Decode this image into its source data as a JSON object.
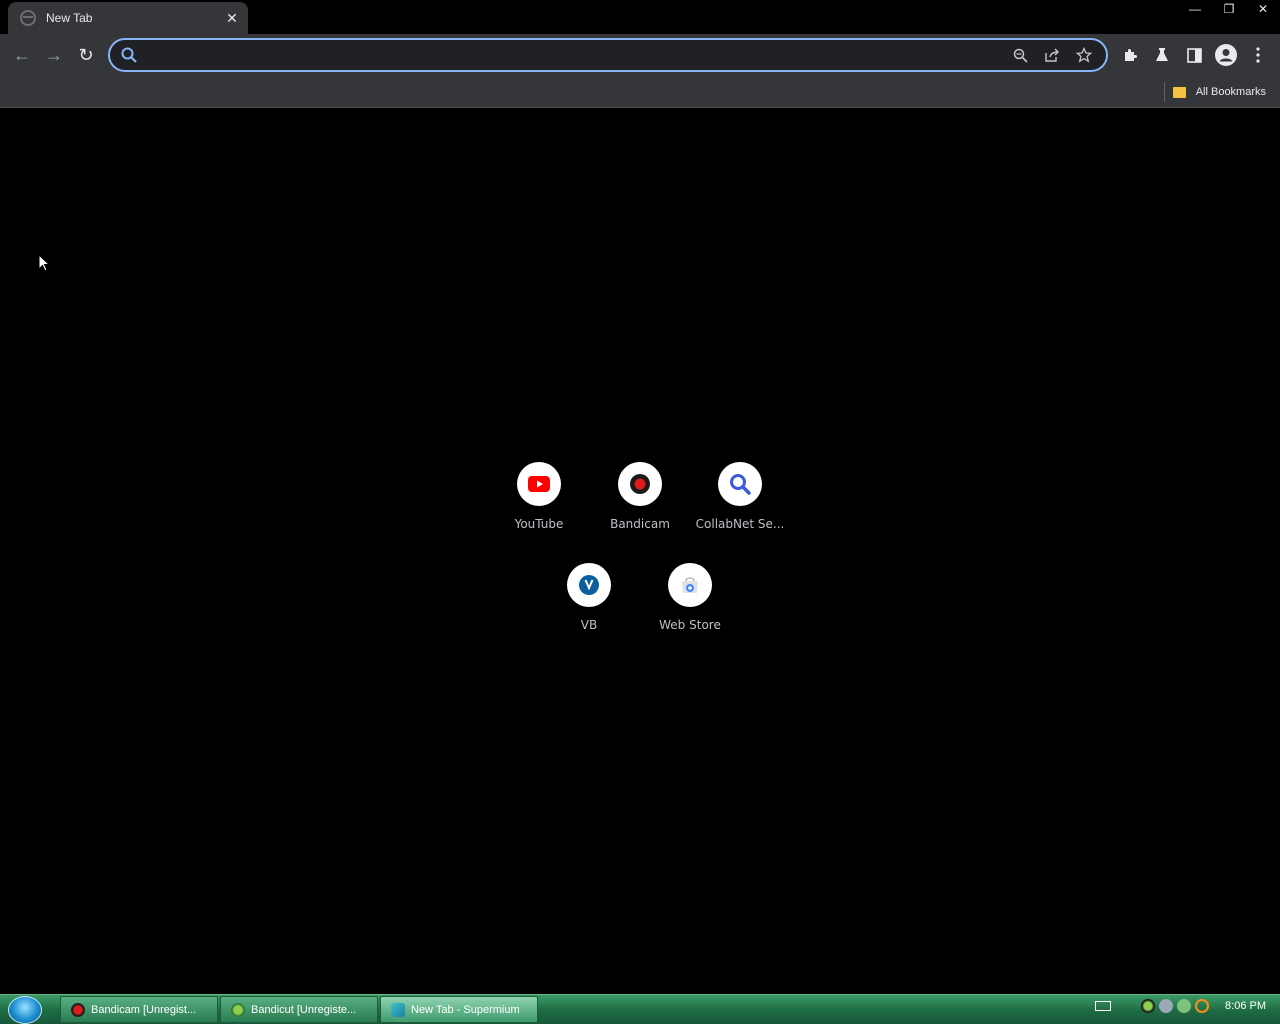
{
  "window": {
    "tab_title": "New Tab",
    "tab_close": "✕",
    "controls": {
      "minimize": "—",
      "restore": "❐",
      "close": "✕"
    }
  },
  "toolbar": {
    "back": "←",
    "forward": "→",
    "reload": "↻",
    "omnibox_value": "",
    "omnibox_placeholder": ""
  },
  "bookmarks": {
    "all_bookmarks": "All Bookmarks"
  },
  "shortcuts": [
    {
      "label": "YouTube",
      "icon": "youtube-icon",
      "color": "#ff0000"
    },
    {
      "label": "Bandicam",
      "icon": "bandicam-icon",
      "color": "#cc0000"
    },
    {
      "label": "CollabNet Se...",
      "icon": "search-icon",
      "color": "#3b5bdb"
    },
    {
      "label": "VB",
      "icon": "vb-icon",
      "color": "#0b5f9e"
    },
    {
      "label": "Web Store",
      "icon": "webstore-icon",
      "color": "#4285f4"
    }
  ],
  "taskbar": {
    "tasks": [
      {
        "label": "Bandicam [Unregist...",
        "icon": "bandicam-icon",
        "active": false
      },
      {
        "label": "Bandicut [Unregiste...",
        "icon": "bandicut-icon",
        "active": false
      },
      {
        "label": "New Tab - Supermium",
        "icon": "supermium-icon",
        "active": true
      }
    ],
    "clock": "8:06 PM"
  },
  "colors": {
    "accent": "#8ab4f8",
    "toolbar_bg": "#35363a",
    "taskbar_green": "#2a7a50"
  }
}
